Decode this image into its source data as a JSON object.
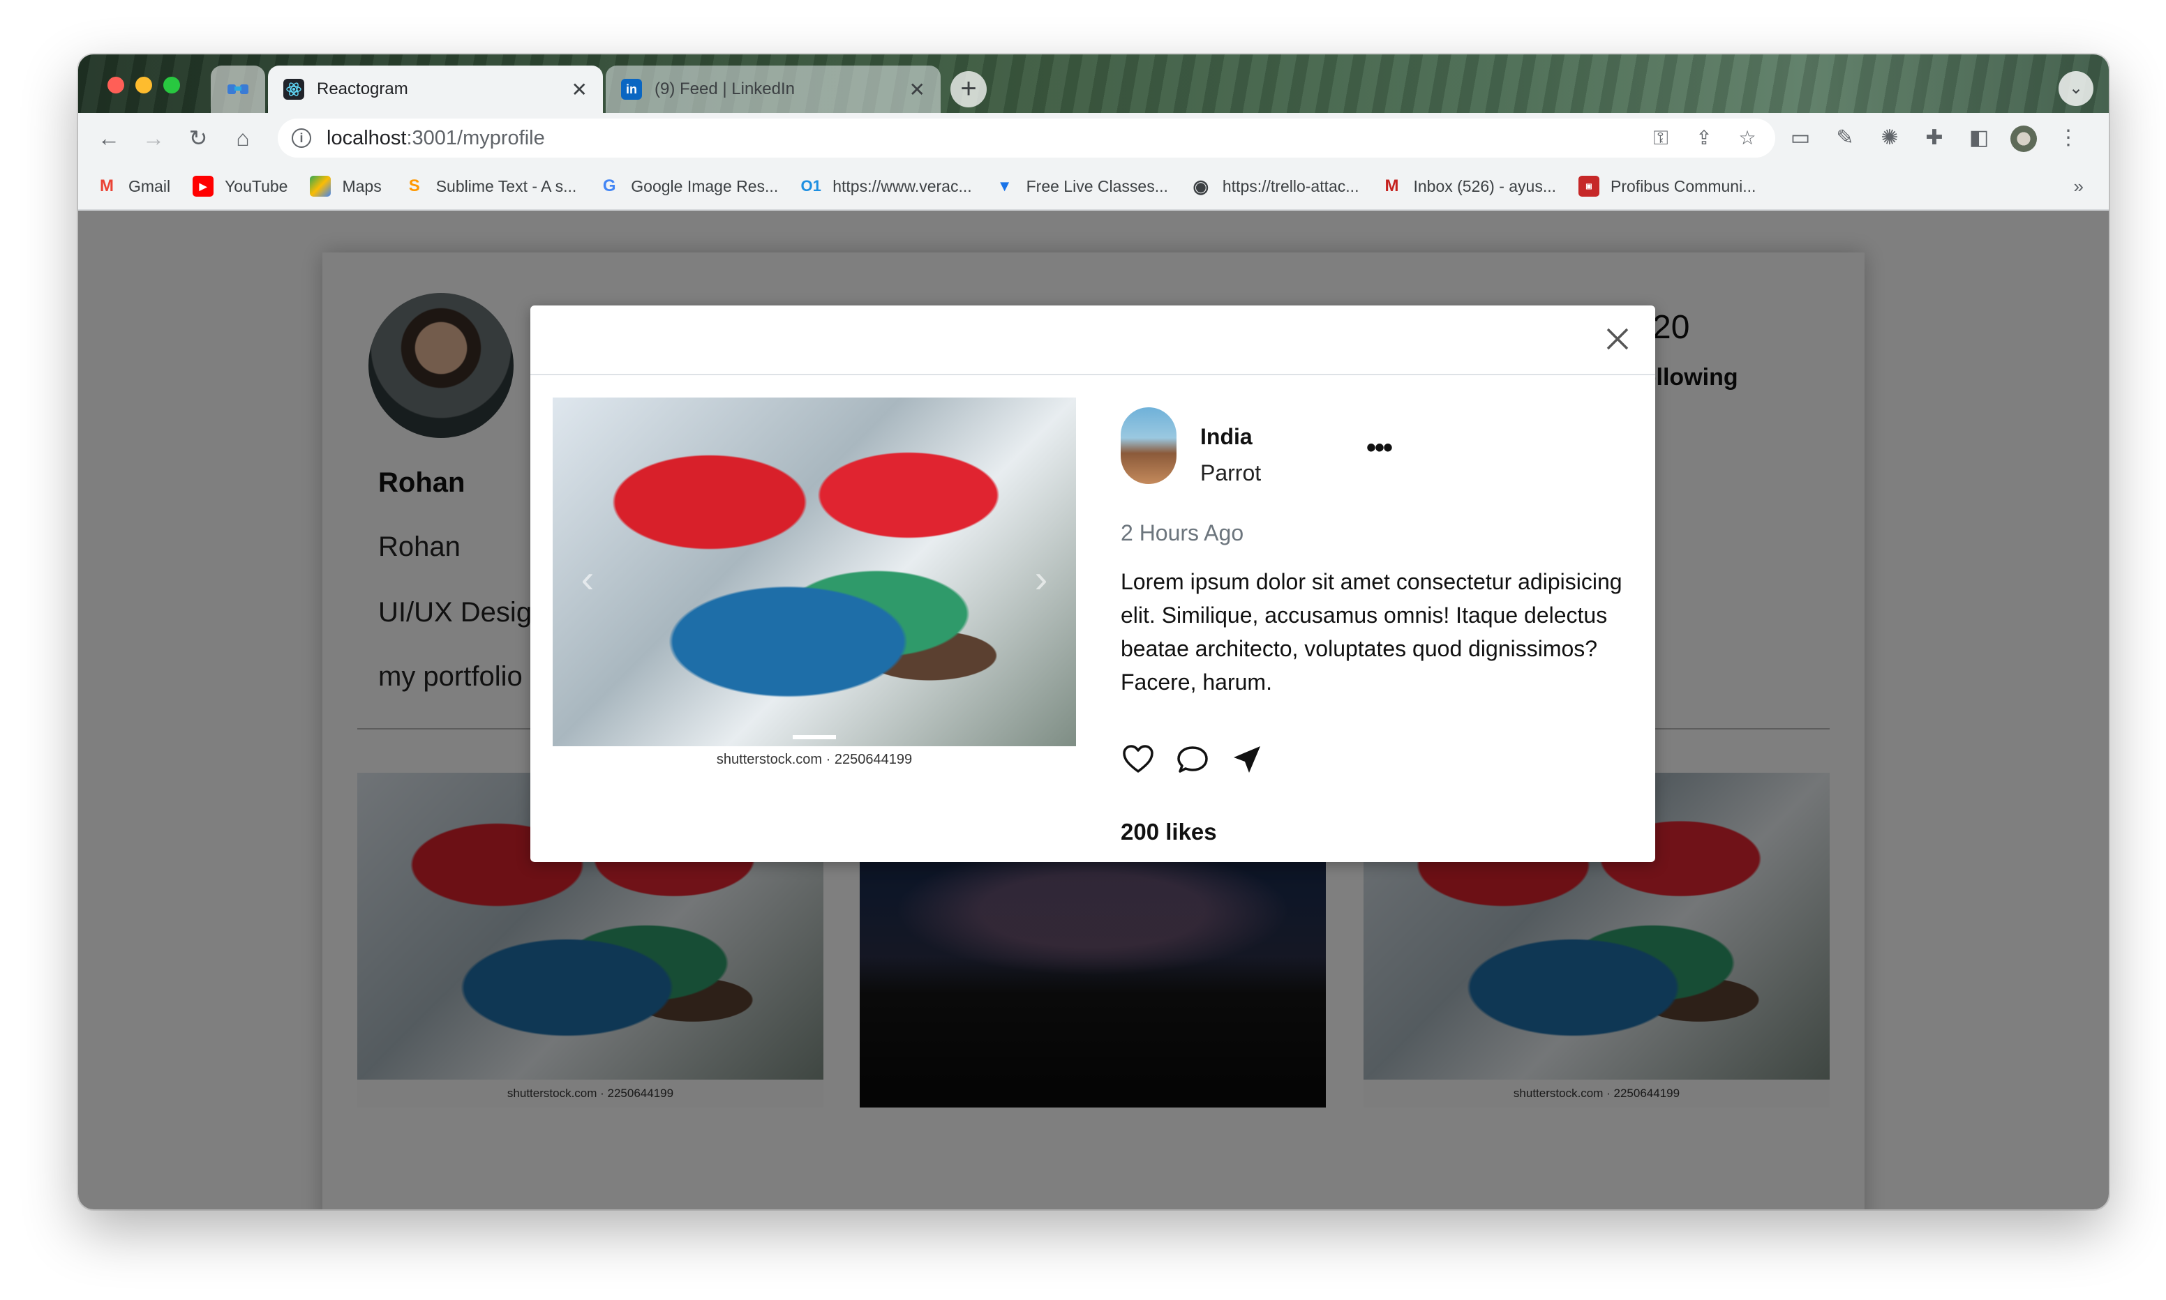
{
  "browser": {
    "tabs": [
      {
        "label": "Reactogram",
        "active": true
      },
      {
        "label": "(9) Feed | LinkedIn",
        "active": false
      }
    ],
    "address": {
      "host": "localhost",
      "path": ":3001/myprofile"
    },
    "bookmarks": [
      {
        "label": "Gmail",
        "icon": "gmail-icon"
      },
      {
        "label": "YouTube",
        "icon": "youtube-icon"
      },
      {
        "label": "Maps",
        "icon": "maps-icon"
      },
      {
        "label": "Sublime Text - A s...",
        "icon": "sublime-icon"
      },
      {
        "label": "Google Image Res...",
        "icon": "google-icon"
      },
      {
        "label": "https://www.verac...",
        "icon": "veracode-icon"
      },
      {
        "label": "Free Live Classes...",
        "icon": "classes-icon"
      },
      {
        "label": "https://trello-attac...",
        "icon": "globe-icon"
      },
      {
        "label": "Inbox (526) - ayus...",
        "icon": "gmail-icon"
      },
      {
        "label": "Profibus Communi...",
        "icon": "profibus-icon"
      }
    ],
    "bookmarks_more": "»"
  },
  "profile": {
    "name": "Rohan",
    "fullname": "Rohan",
    "title": "UI/UX Designer",
    "portfolio": "my portfolio",
    "following_count": "20",
    "following_label": "Following"
  },
  "grid": [
    {
      "type": "parrot",
      "caption": "shutterstock.com · 2250644199"
    },
    {
      "type": "night-sky",
      "caption": ""
    },
    {
      "type": "parrot",
      "caption": "shutterstock.com · 2250644199"
    }
  ],
  "post": {
    "media_caption": "shutterstock.com · 2250644199",
    "author": "India",
    "subtitle": "Parrot",
    "time": "2 Hours Ago",
    "body": "Lorem ipsum dolor sit amet consectetur adipisicing elit. Similique, accusamus omnis! Itaque delectus beatae architecto, voluptates quod dignissimos? Facere, harum.",
    "likes": "200 likes"
  },
  "colors": {
    "overlay": "#000000",
    "modal_bg": "#ffffff",
    "muted_text": "#6c757d"
  }
}
